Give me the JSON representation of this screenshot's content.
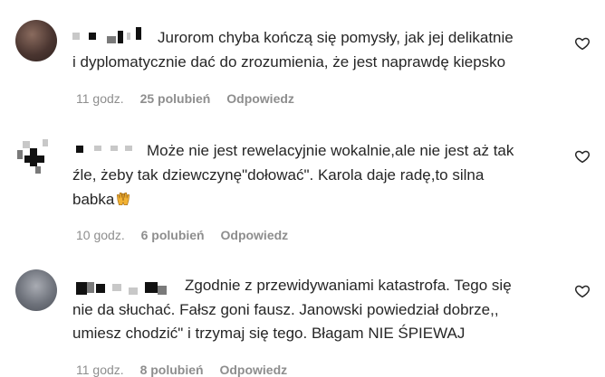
{
  "comments": [
    {
      "text_lines": [
        "Jurorom chyba kończą się pomysły, jak jej delikatnie",
        "i dyplomatycznie dać do zrozumienia, że jest naprawdę kiepsko"
      ],
      "time": "11 godz.",
      "likes": "25 polubień",
      "reply": "Odpowiedz"
    },
    {
      "text_lines": [
        "Może nie jest rewelacyjnie wokalnie,ale nie jest aż tak",
        "źle, żeby tak dziewczynę\"dołować\". Karola daje radę,to silna",
        "babka"
      ],
      "emoji": "raising-hands",
      "time": "10 godz.",
      "likes": "6 polubień",
      "reply": "Odpowiedz"
    },
    {
      "text_lines": [
        "Zgodnie z przewidywaniami katastrofa. Tego się",
        "nie da słuchać. Fałsz goni fausz. Janowski powiedział dobrze,,",
        "umiesz chodzić\" i trzymaj się tego. Błagam NIE ŚPIEWAJ"
      ],
      "time": "11 godz.",
      "likes": "8 polubień",
      "reply": "Odpowiedz"
    }
  ]
}
